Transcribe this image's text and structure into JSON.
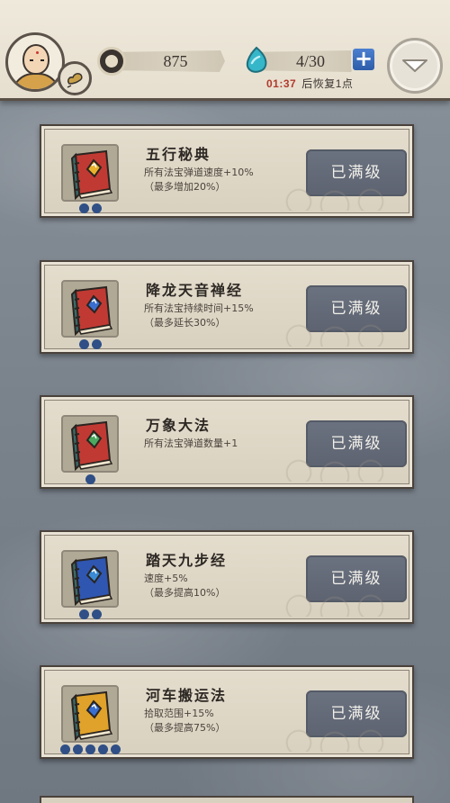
{
  "header": {
    "coins": "875",
    "stamina": "4/30",
    "timer": "01:37",
    "recover_text": "后恢复1点"
  },
  "cards": [
    {
      "title": "五行秘典",
      "desc": "所有法宝弹道速度+10%\n（最多增加20%）",
      "button": "已满级",
      "level": 2,
      "book_color": "#c03a33",
      "gem_color": "#e8b12c"
    },
    {
      "title": "降龙天音禅经",
      "desc": "所有法宝持续时间+15%\n（最多延长30%）",
      "button": "已满级",
      "level": 2,
      "book_color": "#c03a33",
      "gem_color": "#3a6fd0"
    },
    {
      "title": "万象大法",
      "desc": "所有法宝弹道数量+1",
      "button": "已满级",
      "level": 1,
      "book_color": "#c03a33",
      "gem_color": "#4aa860"
    },
    {
      "title": "踏天九步经",
      "desc": "速度+5%\n（最多提高10%）",
      "button": "已满级",
      "level": 2,
      "book_color": "#2f56b0",
      "gem_color": "#3a8ad6"
    },
    {
      "title": "河车搬运法",
      "desc": "拾取范围+15%\n（最多提高75%）",
      "button": "已满级",
      "level": 5,
      "book_color": "#e0a22a",
      "gem_color": "#3a6fd0"
    }
  ]
}
